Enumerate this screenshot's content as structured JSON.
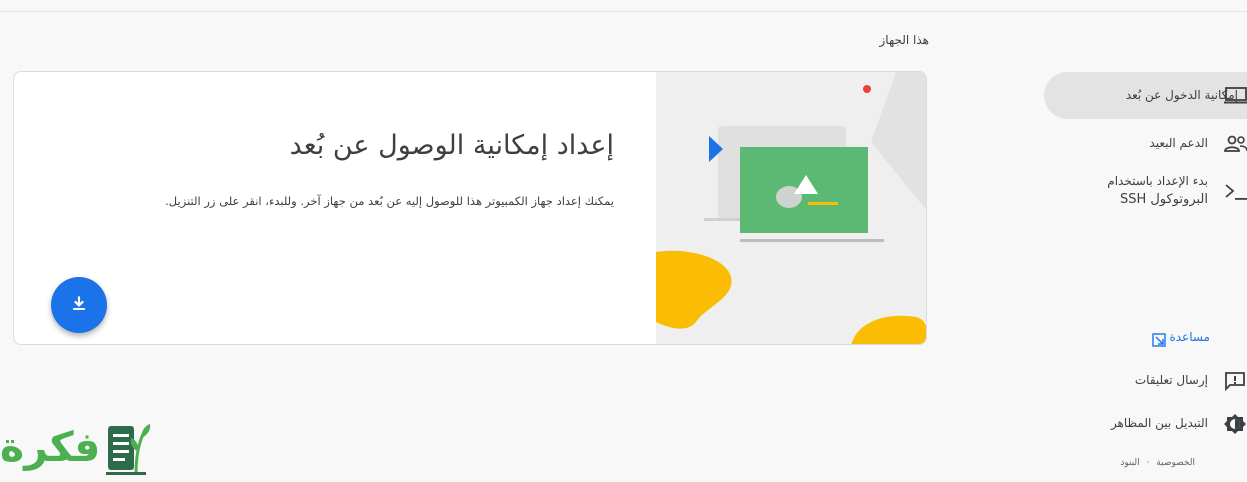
{
  "section": {
    "title": "هذا الجهاز"
  },
  "card": {
    "title": "إعداد إمكانية الوصول عن بُعد",
    "description": "يمكنك إعداد جهاز الكمبيوتر هذا للوصول إليه عن بُعد من جهاز آخر. وللبدء، انقر على زر التنزيل.",
    "download_icon": "download-icon",
    "accent_color": "#1a73e8"
  },
  "nav": {
    "items": [
      {
        "label": "إمكانية الدخول عن بُعد",
        "icon": "laptop-icon",
        "active": true
      },
      {
        "label": "الدعم البعيد",
        "icon": "people-icon",
        "active": false
      },
      {
        "label_line1": "بدء الإعداد باستخدام",
        "label_line2": "البروتوكول SSH",
        "icon": "terminal-icon",
        "active": false
      }
    ],
    "help": {
      "label": "مساعدة",
      "icon": "open-in-new-icon"
    },
    "feedback": {
      "label": "إرسال تعليقات",
      "icon": "feedback-icon"
    },
    "theme": {
      "label": "التبديل بين المظاهر",
      "icon": "brightness-icon"
    },
    "footer": {
      "privacy": "الخصوصية",
      "separator": "·",
      "terms": "البنود"
    }
  },
  "watermark": {
    "text": "فكرة",
    "icon": "notebook-plant-logo"
  }
}
